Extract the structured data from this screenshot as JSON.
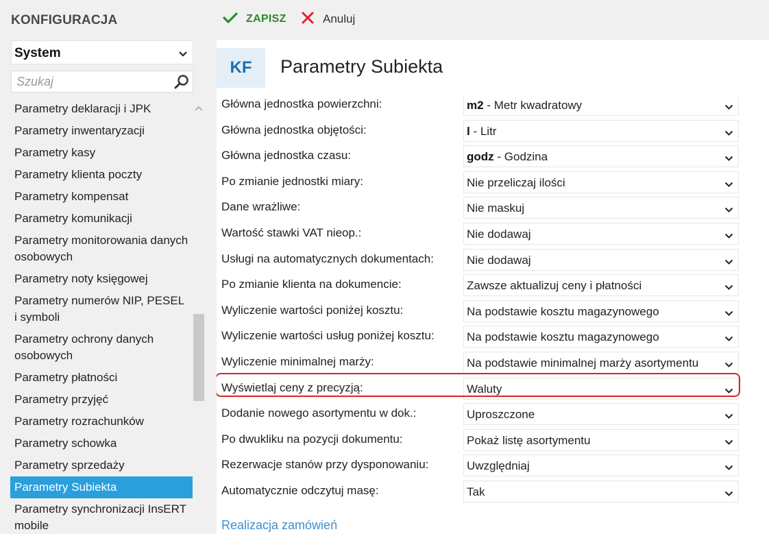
{
  "sidebar": {
    "title": "KONFIGURACJA",
    "module_select": {
      "value": "System"
    },
    "search": {
      "placeholder": "Szukaj"
    },
    "items": [
      {
        "label": "Parametry deklaracji i JPK"
      },
      {
        "label": "Parametry inwentaryzacji"
      },
      {
        "label": "Parametry kasy"
      },
      {
        "label": "Parametry klienta poczty"
      },
      {
        "label": "Parametry kompensat"
      },
      {
        "label": "Parametry komunikacji"
      },
      {
        "label": "Parametry monitorowania danych osobowych"
      },
      {
        "label": "Parametry noty księgowej"
      },
      {
        "label": "Parametry numerów NIP, PESEL i symboli"
      },
      {
        "label": "Parametry ochrony danych osobowych"
      },
      {
        "label": "Parametry płatności"
      },
      {
        "label": "Parametry przyjęć"
      },
      {
        "label": "Parametry rozrachunków"
      },
      {
        "label": "Parametry schowka"
      },
      {
        "label": "Parametry sprzedaży"
      },
      {
        "label": "Parametry Subiekta",
        "active": true
      },
      {
        "label": "Parametry synchronizacji InsERT mobile"
      }
    ]
  },
  "toolbar": {
    "save_label": "ZAPISZ",
    "cancel_label": "Anuluj"
  },
  "header": {
    "badge": "KF",
    "title": "Parametry Subiekta"
  },
  "settings": [
    {
      "label": "Główna jednostka powierzchni:",
      "code": "m2",
      "value": "- Metr kwadratowy"
    },
    {
      "label": "Główna jednostka objętości:",
      "code": "l",
      "value": "- Litr"
    },
    {
      "label": "Główna jednostka czasu:",
      "code": "godz",
      "value": "- Godzina"
    },
    {
      "label": "Po zmianie jednostki miary:",
      "code": "",
      "value": "Nie przeliczaj ilości"
    },
    {
      "label": "Dane wrażliwe:",
      "code": "",
      "value": "Nie maskuj"
    },
    {
      "label": "Wartość stawki VAT nieop.:",
      "code": "",
      "value": "Nie dodawaj"
    },
    {
      "label": "Usługi na automatycznych dokumentach:",
      "code": "",
      "value": "Nie dodawaj"
    },
    {
      "label": "Po zmianie klienta na dokumencie:",
      "code": "",
      "value": "Zawsze aktualizuj ceny i płatności"
    },
    {
      "label": "Wyliczenie wartości poniżej kosztu:",
      "code": "",
      "value": "Na podstawie kosztu magazynowego"
    },
    {
      "label": "Wyliczenie wartości usług poniżej kosztu:",
      "code": "",
      "value": "Na podstawie kosztu magazynowego"
    },
    {
      "label": "Wyliczenie minimalnej marży:",
      "code": "",
      "value": "Na podstawie minimalnej marży asortymentu"
    },
    {
      "label": "Wyświetlaj ceny z precyzją:",
      "code": "",
      "value": "Waluty",
      "highlighted": true
    },
    {
      "label": "Dodanie nowego asortymentu w dok.:",
      "code": "",
      "value": "Uproszczone"
    },
    {
      "label": "Po dwukliku na pozycji dokumentu:",
      "code": "",
      "value": "Pokaż listę asortymentu"
    },
    {
      "label": "Rezerwacje stanów przy dysponowaniu:",
      "code": "",
      "value": "Uwzględniaj"
    },
    {
      "label": "Automatycznie odczytuj masę:",
      "code": "",
      "value": "Tak"
    }
  ],
  "section_link": "Realizacja zamówień",
  "colors": {
    "accent": "#2a9fdc",
    "save": "#2a8a2a",
    "cancel": "#e0202a",
    "highlight": "#e0202a",
    "link": "#3b8fd0"
  },
  "icons": {
    "save": "check-icon",
    "cancel": "close-icon",
    "search": "search-icon",
    "dropdown": "chevron-down-icon"
  }
}
